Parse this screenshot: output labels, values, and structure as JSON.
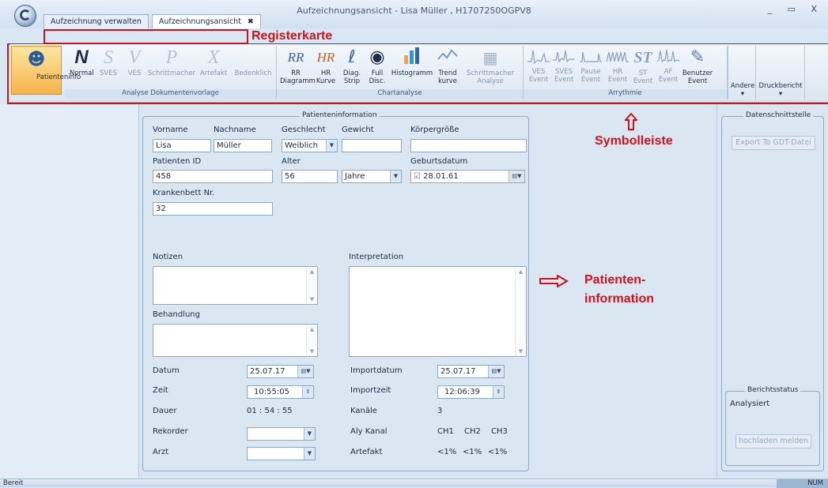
{
  "window": {
    "title": "Aufzeichnungsansicht  -  Lisa Müller , H1707250OGPV8",
    "controls": "_ ▭ X"
  },
  "tabs": [
    {
      "label": "Aufzeichnung verwalten",
      "close": ""
    },
    {
      "label": "Aufzeichnungsansicht",
      "close": "✖"
    }
  ],
  "annotations": {
    "tabs": "Registerkarte",
    "toolbar": "Symbolleiste",
    "patient_info_line1": "Patienten-",
    "patient_info_line2": "information"
  },
  "ribbon": {
    "patient_info": "Patienteninfo",
    "analysis_group": {
      "label": "Analyse Dokumentenvorlage",
      "items": [
        "Normal",
        "SVES",
        "VES",
        "Schrittmacher",
        "Artefakt",
        "Bedenklich"
      ]
    },
    "chart_group": {
      "label": "Chartanalyse",
      "items": [
        {
          "l1": "RR",
          "l2": "Diagramm"
        },
        {
          "l1": "HR",
          "l2": "Kurve"
        },
        {
          "l1": "Diag.",
          "l2": "Strip"
        },
        {
          "l1": "Full",
          "l2": "Disc."
        },
        {
          "l1": "Histogramm",
          "l2": ""
        },
        {
          "l1": "Trend",
          "l2": "kurve"
        },
        {
          "l1": "Schrittmacher",
          "l2": "Analyse"
        }
      ]
    },
    "arrhythmia_group": {
      "label": "Arrythmie",
      "items": [
        {
          "l1": "VES",
          "l2": "Event"
        },
        {
          "l1": "SVES",
          "l2": "Event"
        },
        {
          "l1": "Pause",
          "l2": "Event"
        },
        {
          "l1": "HR",
          "l2": "Event"
        },
        {
          "l1": "ST",
          "l2": "Event"
        },
        {
          "l1": "AF",
          "l2": "Event"
        },
        {
          "l1": "Benutzer",
          "l2": "Event"
        }
      ]
    },
    "other": "Andere",
    "print_report": "Druckbericht",
    "dropdown_arrow": "▾"
  },
  "patient": {
    "legend": "Patienteninformation",
    "first_name_label": "Vorname",
    "first_name": "Lisa",
    "last_name_label": "Nachname",
    "last_name": "Müller",
    "gender_label": "Geschlecht",
    "gender": "Weiblich",
    "weight_label": "Gewicht",
    "weight": "",
    "height_label": "Körpergröße",
    "height": "",
    "patient_id_label": "Patienten ID",
    "patient_id": "458",
    "age_label": "Alter",
    "age": "56",
    "age_unit": "Jahre",
    "birth_label": "Geburtsdatum",
    "birth_date": "28.01.61",
    "bed_label": "Krankenbett Nr.",
    "bed": "32",
    "notes_label": "Notizen",
    "interpretation_label": "Interpretation",
    "treatment_label": "Behandlung"
  },
  "recording": {
    "date_label": "Datum",
    "date": "25.07.17",
    "time_label": "Zeit",
    "time": "10:55:05",
    "duration_label": "Dauer",
    "duration": "01 : 54 : 55",
    "recorder_label": "Rekorder",
    "physician_label": "Arzt",
    "import_date_label": "Importdatum",
    "import_date": "25.07.17",
    "import_time_label": "Importzeit",
    "import_time": "12:06:39",
    "channels_label": "Kanäle",
    "channels": "3",
    "aly_label": "Aly Kanal",
    "aly": [
      "CH1",
      "CH2",
      "CH3"
    ],
    "artifact_label": "Artefakt",
    "artifact": [
      "<1%",
      "<1%",
      "<1%"
    ]
  },
  "interface": {
    "legend": "Datenschnittstelle",
    "export_button": "Export To GDT-Datei",
    "status_legend": "Berichtsstatus",
    "status": "Analysiert",
    "upload_button": "hochladen melden"
  },
  "statusbar": {
    "left": "Bereit",
    "right": "NUM"
  }
}
